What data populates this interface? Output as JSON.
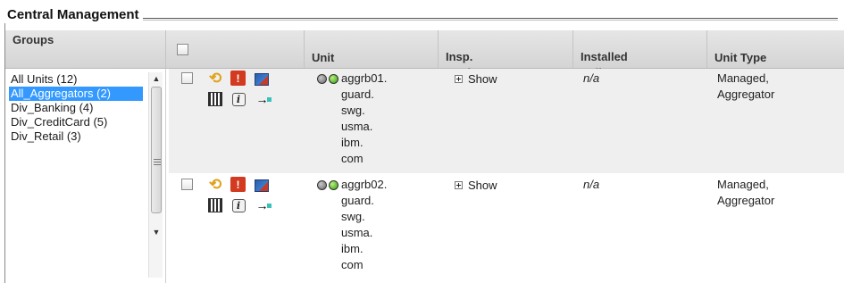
{
  "panel": {
    "title": "Central Management"
  },
  "table": {
    "headers": {
      "groups": "Groups",
      "unit": "Unit",
      "insp_engines": "Insp.\nEngines",
      "installed_policy": "Installed\nPolicy",
      "unit_type": "Unit Type"
    },
    "groups": [
      {
        "label": "All Units (12)",
        "selected": false
      },
      {
        "label": "All_Aggregators (2)",
        "selected": true
      },
      {
        "label": "Div_Banking (4)",
        "selected": false
      },
      {
        "label": "Div_CreditCard (5)",
        "selected": false
      },
      {
        "label": "Div_Retail (3)",
        "selected": false
      }
    ],
    "rows": [
      {
        "unit_name": "aggrb01.\nguard.\nswg.\nusma.\nibm.\ncom",
        "insp_engines_action": "Show",
        "installed_policy": "n/a",
        "unit_type": "Managed,\nAggregator"
      },
      {
        "unit_name": "aggrb02.\nguard.\nswg.\nusma.\nibm.\ncom",
        "insp_engines_action": "Show",
        "installed_policy": "n/a",
        "unit_type": "Managed,\nAggregator"
      }
    ]
  },
  "icons": {
    "row_actions": [
      "refresh-cycle-icon",
      "stop-icon",
      "monitor-icon",
      "panel-icon",
      "info-icon",
      "arrow-connect-icon"
    ],
    "status": [
      "grey-status-icon",
      "green-status-icon"
    ]
  },
  "colors": {
    "selection": "#3399ff",
    "header_bg": "#dcdcdc",
    "row_alt_bg": "#efefef",
    "stop_red": "#d23b1f",
    "status_green": "#2f9a13"
  }
}
